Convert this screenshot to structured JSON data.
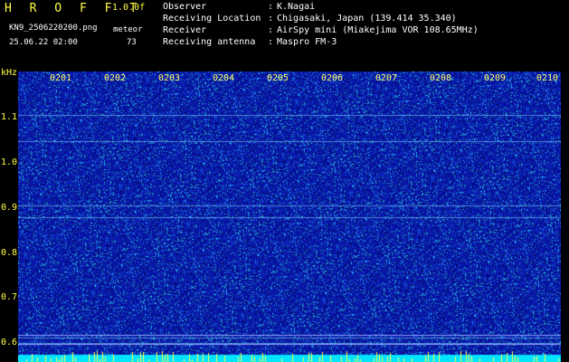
{
  "header": {
    "app_title": "H R O F F T",
    "version": "1.0.0f",
    "filename": "KN9_2506220200.png",
    "counter_label": "meteor",
    "counter_value": "73",
    "datetime": "25.06.22 02:00"
  },
  "info": [
    {
      "label": "Observer",
      "value": "K.Nagai"
    },
    {
      "label": "Receiving Location",
      "value": "Chigasaki, Japan (139.414 35.340)"
    },
    {
      "label": "Receiver",
      "value": "AirSpy mini (Miakejima VOR 108.65MHz)"
    },
    {
      "label": "Receiving antenna",
      "value": "Maspro FM-3"
    }
  ],
  "spectrogram": {
    "y_unit": "kHz",
    "y_ticks": [
      "1.1",
      "1.0",
      "0.9",
      "0.8",
      "0.7",
      "0.6"
    ],
    "x_ticks": [
      "0201",
      "0202",
      "0203",
      "0204",
      "0205",
      "0206",
      "0207",
      "0208",
      "0209",
      "0210"
    ],
    "background_color": "#0a1aa8",
    "noise_color": "#33ccff",
    "bottom_strip_color": "#00e5ff",
    "tick_color": "#ffff44"
  }
}
